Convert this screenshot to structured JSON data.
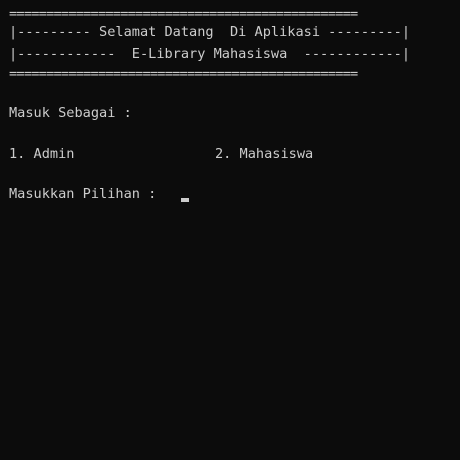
{
  "banner": {
    "top_border": "===============================================",
    "line1": "|--------- Selamat Datang  Di Aplikasi ---------|",
    "line2": "|------------  E-Library Mahasiswa  ------------|",
    "bottom_border": "==============================================="
  },
  "menu": {
    "prompt": "Masuk Sebagai :",
    "option_admin": "1. Admin",
    "option_mahasiswa": "2. Mahasiswa"
  },
  "input": {
    "prompt": "Masukkan Pilihan :",
    "value": ""
  },
  "colors": {
    "background": "#0c0c0c",
    "text": "#cccccc"
  }
}
